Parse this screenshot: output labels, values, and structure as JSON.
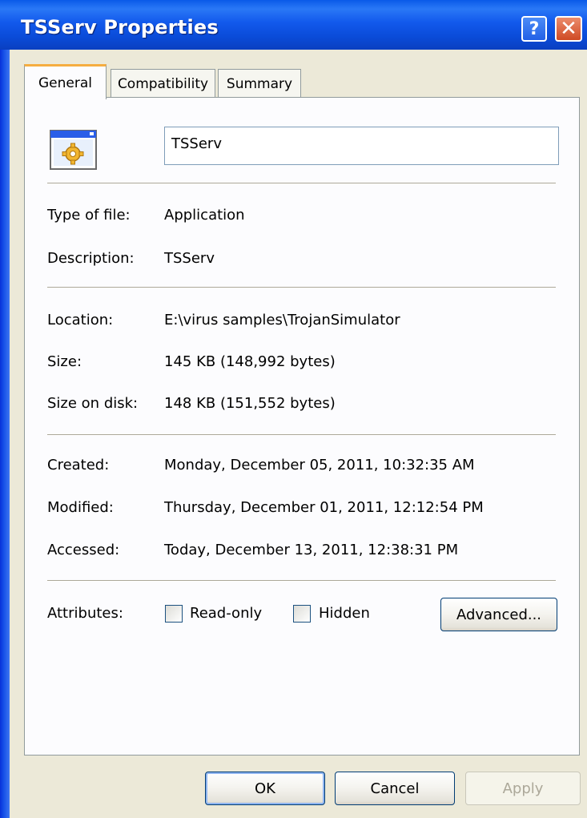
{
  "window": {
    "title": "TSServ Properties",
    "help_glyph": "?",
    "close_glyph": "✕"
  },
  "tabs": [
    {
      "label": "General",
      "active": true
    },
    {
      "label": "Compatibility",
      "active": false
    },
    {
      "label": "Summary",
      "active": false
    }
  ],
  "general": {
    "file_name": "TSServ",
    "icon": "application-icon",
    "type_of_file": {
      "label": "Type of file:",
      "value": "Application"
    },
    "description": {
      "label": "Description:",
      "value": "TSServ"
    },
    "location": {
      "label": "Location:",
      "value": "E:\\virus samples\\TrojanSimulator"
    },
    "size": {
      "label": "Size:",
      "value": "145 KB (148,992 bytes)"
    },
    "size_on_disk": {
      "label": "Size on disk:",
      "value": "148 KB (151,552 bytes)"
    },
    "created": {
      "label": "Created:",
      "value": "Monday, December 05, 2011, 10:32:35 AM"
    },
    "modified": {
      "label": "Modified:",
      "value": "Thursday, December 01, 2011, 12:12:54 PM"
    },
    "accessed": {
      "label": "Accessed:",
      "value": "Today, December 13, 2011, 12:38:31 PM"
    },
    "attributes": {
      "label": "Attributes:",
      "read_only": {
        "label": "Read-only",
        "checked": false
      },
      "hidden": {
        "label": "Hidden",
        "checked": false
      },
      "advanced_label": "Advanced..."
    }
  },
  "buttons": {
    "ok": "OK",
    "cancel": "Cancel",
    "apply": "Apply",
    "apply_disabled": true
  },
  "colors": {
    "titlebar": "#0a5ae8",
    "dialog_bg": "#ece9d8",
    "active_tab_accent": "#f5ad41",
    "close_button": "#cf4a24"
  }
}
